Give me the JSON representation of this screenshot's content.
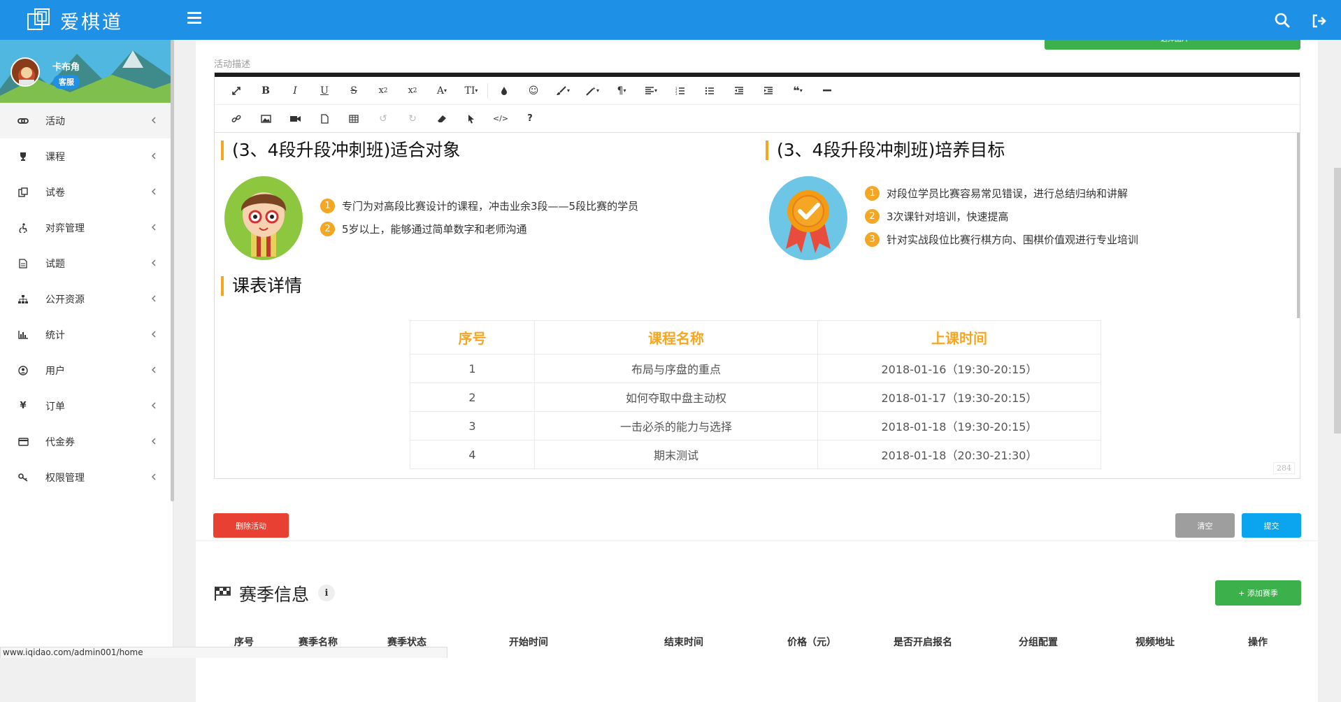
{
  "app": {
    "name": "爱棋道"
  },
  "header": {
    "icons": [
      "logo-icon",
      "menu-icon",
      "search-icon",
      "logout-icon"
    ]
  },
  "profile": {
    "name": "卡布角",
    "role": "客服"
  },
  "sidebar": {
    "items": [
      {
        "label": "活动",
        "icon": "link-icon"
      },
      {
        "label": "课程",
        "icon": "trophy-icon"
      },
      {
        "label": "试卷",
        "icon": "copy-icon"
      },
      {
        "label": "对弈管理",
        "icon": "accessibility-icon"
      },
      {
        "label": "试题",
        "icon": "file-icon"
      },
      {
        "label": "公开资源",
        "icon": "sitemap-icon"
      },
      {
        "label": "统计",
        "icon": "bar-chart-icon"
      },
      {
        "label": "用户",
        "icon": "user-circle-icon"
      },
      {
        "label": "订单",
        "icon": "yen-icon"
      },
      {
        "label": "代金券",
        "icon": "credit-card-icon"
      },
      {
        "label": "权限管理",
        "icon": "key-icon"
      }
    ]
  },
  "form": {
    "description_label": "活动描述",
    "top_button_label": "选择图片"
  },
  "editor": {
    "char_count": "284",
    "content": {
      "left_title": "(3、4段升段冲刺班)适合对象",
      "left_points": [
        {
          "num": "1",
          "text": "专门为对高段比赛设计的课程，冲击业余3段——5段比赛的学员"
        },
        {
          "num": "2",
          "text": "5岁以上，能够通过简单数字和老师沟通"
        }
      ],
      "right_title": "(3、4段升段冲刺班)培养目标",
      "right_points": [
        {
          "num": "1",
          "text": "对段位学员比赛容易常见错误，进行总结归纳和讲解"
        },
        {
          "num": "2",
          "text": "3次课针对培训，快速提高"
        },
        {
          "num": "3",
          "text": "针对实战段位比赛行棋方向、围棋价值观进行专业培训"
        }
      ],
      "schedule_title": "课表详情",
      "schedule": {
        "headers": [
          "序号",
          "课程名称",
          "上课时间"
        ],
        "rows": [
          [
            "1",
            "布局与序盘的重点",
            "2018-01-16（19:30-20:15）"
          ],
          [
            "2",
            "如何夺取中盘主动权",
            "2018-01-17（19:30-20:15）"
          ],
          [
            "3",
            "一击必杀的能力与选择",
            "2018-01-18（19:30-20:15）"
          ],
          [
            "4",
            "期末测试",
            "2018-01-18（20:30-21:30）"
          ]
        ]
      }
    }
  },
  "actions": {
    "delete": "删除活动",
    "clear": "清空",
    "submit": "提交"
  },
  "season": {
    "title": "赛季信息",
    "info_symbol": "i",
    "add_button": "+ 添加赛季",
    "columns": [
      "序号",
      "赛季名称",
      "赛季状态",
      "开始时间",
      "结束时间",
      "价格（元）",
      "是否开启报名",
      "分组配置",
      "视频地址",
      "操作"
    ]
  },
  "status_bar": {
    "url": "www.iqidao.com/admin001/home"
  },
  "colors": {
    "header": "#1e90e6",
    "accent": "#f5a623",
    "green": "#3cb04a",
    "red": "#e84033",
    "blue": "#0aa5ee",
    "gray": "#9e9e9e"
  }
}
